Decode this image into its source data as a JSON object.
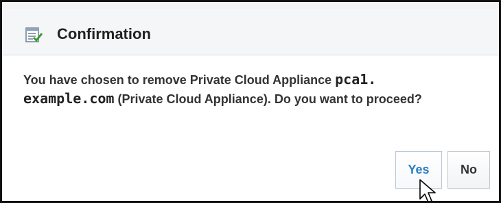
{
  "dialog": {
    "title": "Confirmation",
    "header_icon": "confirmation-icon",
    "message": {
      "part1": "You have chosen to remove Private Cloud Appliance ",
      "target_name_line1": "pca1.",
      "target_name_line2": "example.com",
      "part2": " (Private Cloud Appliance). Do you want to proceed?"
    },
    "buttons": {
      "yes_label": "Yes",
      "no_label": "No"
    }
  },
  "colors": {
    "header_bg": "#f5f6f7",
    "yes_text": "#2a7fc4",
    "text": "#333333"
  },
  "cursor_icon": "mouse-pointer-icon"
}
